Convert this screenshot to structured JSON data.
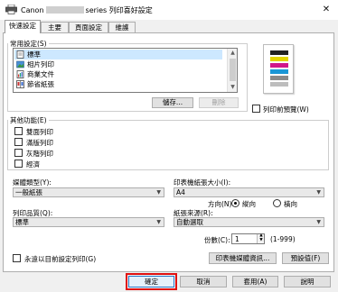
{
  "window": {
    "title_prefix": "Canon",
    "title_suffix": "series 列印喜好設定",
    "close_glyph": "✕"
  },
  "tabs": [
    {
      "label": "快速設定",
      "active": true
    },
    {
      "label": "主要",
      "active": false
    },
    {
      "label": "頁面設定",
      "active": false
    },
    {
      "label": "維護",
      "active": false
    }
  ],
  "common_settings": {
    "label": "常用設定(S)",
    "items": [
      {
        "label": "標準",
        "selected": true,
        "icon": "standard-document-icon"
      },
      {
        "label": "相片列印",
        "selected": false,
        "icon": "photo-print-icon"
      },
      {
        "label": "商業文件",
        "selected": false,
        "icon": "business-document-icon"
      },
      {
        "label": "節省紙張",
        "selected": false,
        "icon": "paper-saving-icon"
      }
    ],
    "save_button": "儲存...",
    "delete_button": "刪除"
  },
  "preview": {
    "checkbox_label": "列印前預覽(W)",
    "checked": false
  },
  "additional_features": {
    "label": "其他功能(E)",
    "items": [
      {
        "label": "雙面列印",
        "checked": false
      },
      {
        "label": "滿版列印",
        "checked": false
      },
      {
        "label": "灰階列印",
        "checked": false
      },
      {
        "label": "經濟",
        "checked": false
      }
    ]
  },
  "media_type": {
    "label": "媒體類型(Y):",
    "value": "一般紙張"
  },
  "printer_paper_size": {
    "label": "印表機紙張大小(I):",
    "value": "A4"
  },
  "orientation": {
    "label": "方向(N):",
    "options": [
      {
        "label": "縱向",
        "selected": true
      },
      {
        "label": "橫向",
        "selected": false
      }
    ]
  },
  "print_quality": {
    "label": "列印品質(Q):",
    "value": "標準"
  },
  "paper_source": {
    "label": "紙張來源(R):",
    "value": "自動選取"
  },
  "copies": {
    "label": "份數(C):",
    "value": "1",
    "range": "(1-999)"
  },
  "always_print_current": {
    "label": "永遠以目前設定列印(G)",
    "checked": false
  },
  "printer_media_info_button": "印表機媒體資訊...",
  "defaults_button": "預設值(F)",
  "footer": {
    "ok": "確定",
    "cancel": "取消",
    "apply": "套用(A)",
    "help": "說明"
  },
  "colors": {
    "ok_highlight": "#e01010",
    "selection": "#cde8ff"
  }
}
